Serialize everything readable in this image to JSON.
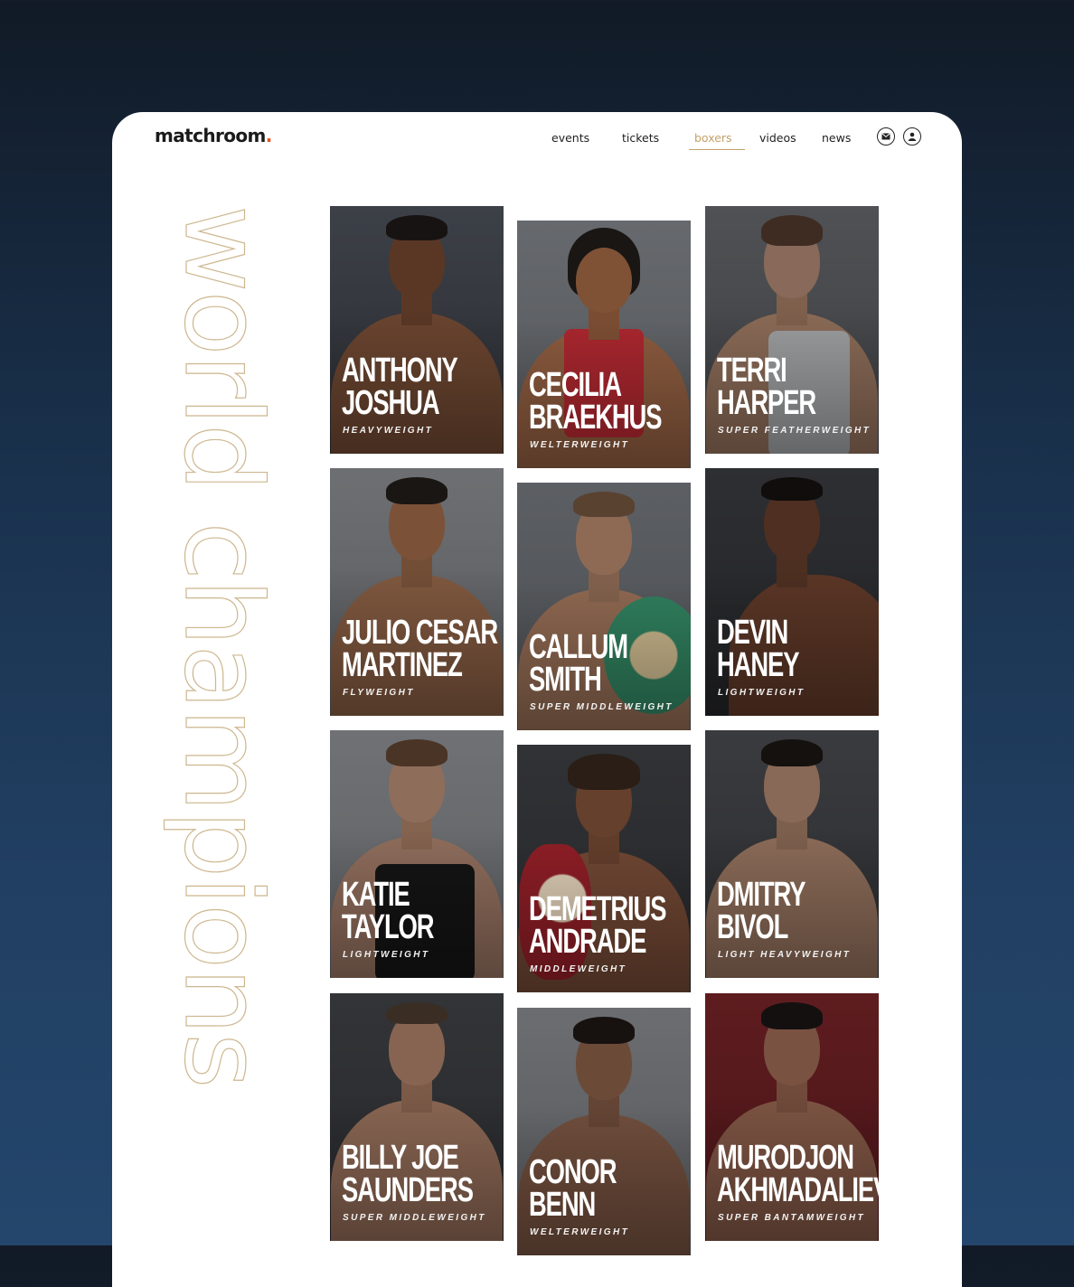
{
  "header": {
    "logo": {
      "text": "matchroom",
      "dot": ".",
      "dot_color": "#e0541f"
    },
    "nav": [
      {
        "label": "events",
        "active": false
      },
      {
        "label": "tickets",
        "active": false
      },
      {
        "label": "boxers",
        "active": true
      },
      {
        "label": "videos",
        "active": false
      },
      {
        "label": "news",
        "active": false
      }
    ],
    "icons": [
      "mail-icon",
      "user-icon"
    ],
    "accent_color": "#c4a16a"
  },
  "page": {
    "title": "world champions"
  },
  "boxers": [
    {
      "first": "ANTHONY",
      "last": "JOSHUA",
      "division": "HEAVYWEIGHT"
    },
    {
      "first": "CECILIA",
      "last": "BRAEKHUS",
      "division": "WELTERWEIGHT"
    },
    {
      "first": "TERRI",
      "last": "HARPER",
      "division": "SUPER FEATHERWEIGHT"
    },
    {
      "first": "JULIO CESAR",
      "last": "MARTINEZ",
      "division": "FLYWEIGHT"
    },
    {
      "first": "CALLUM",
      "last": "SMITH",
      "division": "SUPER MIDDLEWEIGHT"
    },
    {
      "first": "DEVIN",
      "last": "HANEY",
      "division": "LIGHTWEIGHT"
    },
    {
      "first": "KATIE",
      "last": "TAYLOR",
      "division": "LIGHTWEIGHT"
    },
    {
      "first": "DEMETRIUS",
      "last": "ANDRADE",
      "division": "MIDDLEWEIGHT"
    },
    {
      "first": "DMITRY",
      "last": "BIVOL",
      "division": "LIGHT HEAVYWEIGHT"
    },
    {
      "first": "BILLY JOE",
      "last": "SAUNDERS",
      "division": "SUPER MIDDLEWEIGHT"
    },
    {
      "first": "CONOR",
      "last": "BENN",
      "division": "WELTERWEIGHT"
    },
    {
      "first": "MURODJON",
      "last": "AKHMADALIEV",
      "division": "SUPER BANTAMWEIGHT"
    }
  ]
}
